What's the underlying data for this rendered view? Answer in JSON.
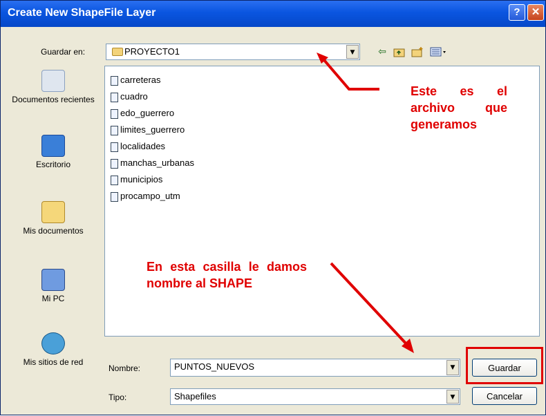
{
  "window": {
    "title": "Create New ShapeFile Layer"
  },
  "location": {
    "label": "Guardar en:",
    "value": "PROYECTO1"
  },
  "toolbar": {
    "icons": [
      "back-icon",
      "up-folder-icon",
      "new-folder-icon",
      "view-menu-icon"
    ]
  },
  "places": [
    {
      "label": "Documentos recientes",
      "icon": "recent-documents-icon"
    },
    {
      "label": "Escritorio",
      "icon": "desktop-icon"
    },
    {
      "label": "Mis documentos",
      "icon": "my-documents-icon"
    },
    {
      "label": "Mi PC",
      "icon": "my-computer-icon"
    },
    {
      "label": "Mis sitios de red",
      "icon": "network-places-icon"
    }
  ],
  "files": [
    "carreteras",
    "cuadro",
    "edo_guerrero",
    "limites_guerrero",
    "localidades",
    "manchas_urbanas",
    "municipios",
    "procampo_utm"
  ],
  "annotations": {
    "top": "Este es el archivo que generamos",
    "bottom": "En esta casilla le damos nombre al SHAPE",
    "color": "#e00000"
  },
  "form": {
    "name_label": "Nombre:",
    "name_value": "PUNTOS_NUEVOS",
    "type_label": "Tipo:",
    "type_value": "Shapefiles"
  },
  "buttons": {
    "save": "Guardar",
    "cancel": "Cancelar"
  }
}
